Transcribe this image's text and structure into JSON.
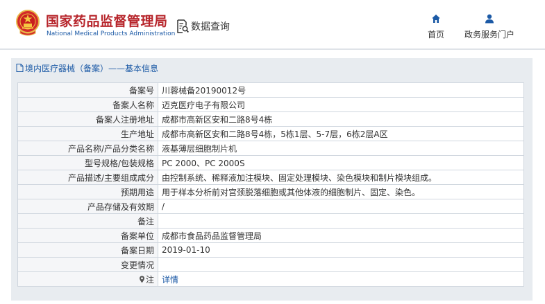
{
  "header": {
    "org_name_cn": "国家药品监督管理局",
    "org_name_en": "National Medical Products Administration",
    "query_label": "数据查询",
    "query_icon": "document-search-icon",
    "nav": [
      {
        "label": "首页",
        "icon": "home-icon"
      },
      {
        "label": "政务服务门户",
        "icon": "user-icon"
      }
    ]
  },
  "panel": {
    "title": "境内医疗器械（备案）——基本信息",
    "title_icon": "document-icon"
  },
  "record": {
    "rows": [
      {
        "label": "备案号",
        "value": "川蓉械备20190012号"
      },
      {
        "label": "备案人名称",
        "value": "迈克医疗电子有限公司"
      },
      {
        "label": "备案人注册地址",
        "value": "成都市高新区安和二路8号4栋"
      },
      {
        "label": "生产地址",
        "value": "成都市高新区安和二路8号4栋，5栋1层、5-7层，6栋2层A区"
      },
      {
        "label": "产品名称/产品分类名称",
        "value": "液基薄层细胞制片机"
      },
      {
        "label": "型号规格/包装规格",
        "value": "PC 2000、PC 2000S"
      },
      {
        "label": "产品描述/主要组成成分",
        "value": "由控制系统、稀释液加注模块、固定处理模块、染色模块和制片模块组成。"
      },
      {
        "label": "预期用途",
        "value": "用于样本分析前对宫颈脱落细胞或其他体液的细胞制片、固定、染色。"
      },
      {
        "label": "产品存储及有效期",
        "value": "/"
      },
      {
        "label": "备注",
        "value": ""
      },
      {
        "label": "备案单位",
        "value": "成都市食品药品监督管理局"
      },
      {
        "label": "备案日期",
        "value": "2019-01-10"
      },
      {
        "label": "变更情况",
        "value": ""
      }
    ],
    "note_label": "注",
    "note_icon": "pin-icon",
    "detail_link": "详情"
  },
  "colors": {
    "brand_red": "#b7252b",
    "link_blue": "#1c5aa6",
    "panel_bg": "#e8ecf0",
    "border": "#cfd6de"
  }
}
